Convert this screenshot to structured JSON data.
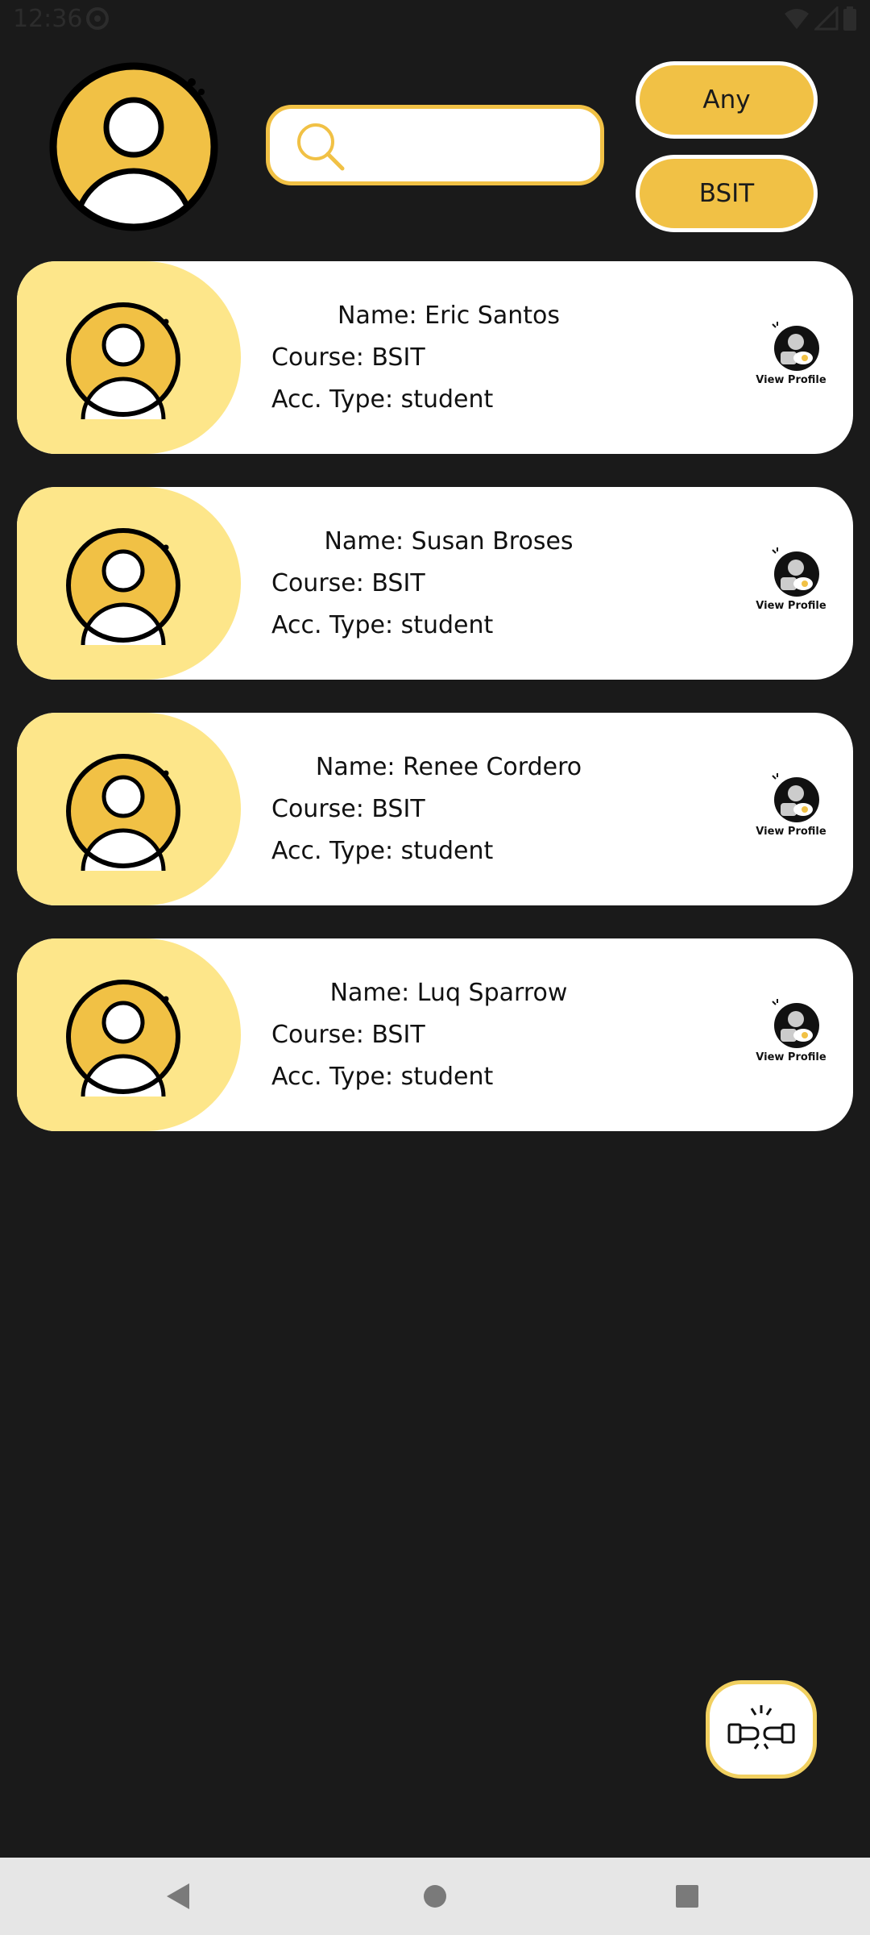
{
  "status_bar": {
    "time": "12:36",
    "icons": [
      "do-not-disturb-icon",
      "wifi-icon",
      "cellular-signal-icon",
      "battery-icon"
    ]
  },
  "colors": {
    "background": "#1a1a1a",
    "accent": "#f1c145",
    "card_left": "#fde68a",
    "card": "#ffffff"
  },
  "search": {
    "placeholder": "",
    "value": ""
  },
  "filters": {
    "account_type": "Any",
    "course": "BSIT"
  },
  "users": [
    {
      "name": "Name: Eric Santos",
      "course": "Course: BSIT",
      "acc_type": "Acc. Type: student",
      "action": "View Profile"
    },
    {
      "name": "Name: Susan Broses",
      "course": "Course: BSIT",
      "acc_type": "Acc. Type: student",
      "action": "View Profile"
    },
    {
      "name": "Name: Renee Cordero",
      "course": "Course: BSIT",
      "acc_type": "Acc. Type: student",
      "action": "View Profile"
    },
    {
      "name": "Name: Luq Sparrow",
      "course": "Course: BSIT",
      "acc_type": "Acc. Type: student",
      "action": "View Profile"
    }
  ],
  "fab": {
    "icon": "fist-bump-icon"
  },
  "nav": {
    "icons": [
      "back-icon",
      "home-icon",
      "recents-icon"
    ]
  }
}
